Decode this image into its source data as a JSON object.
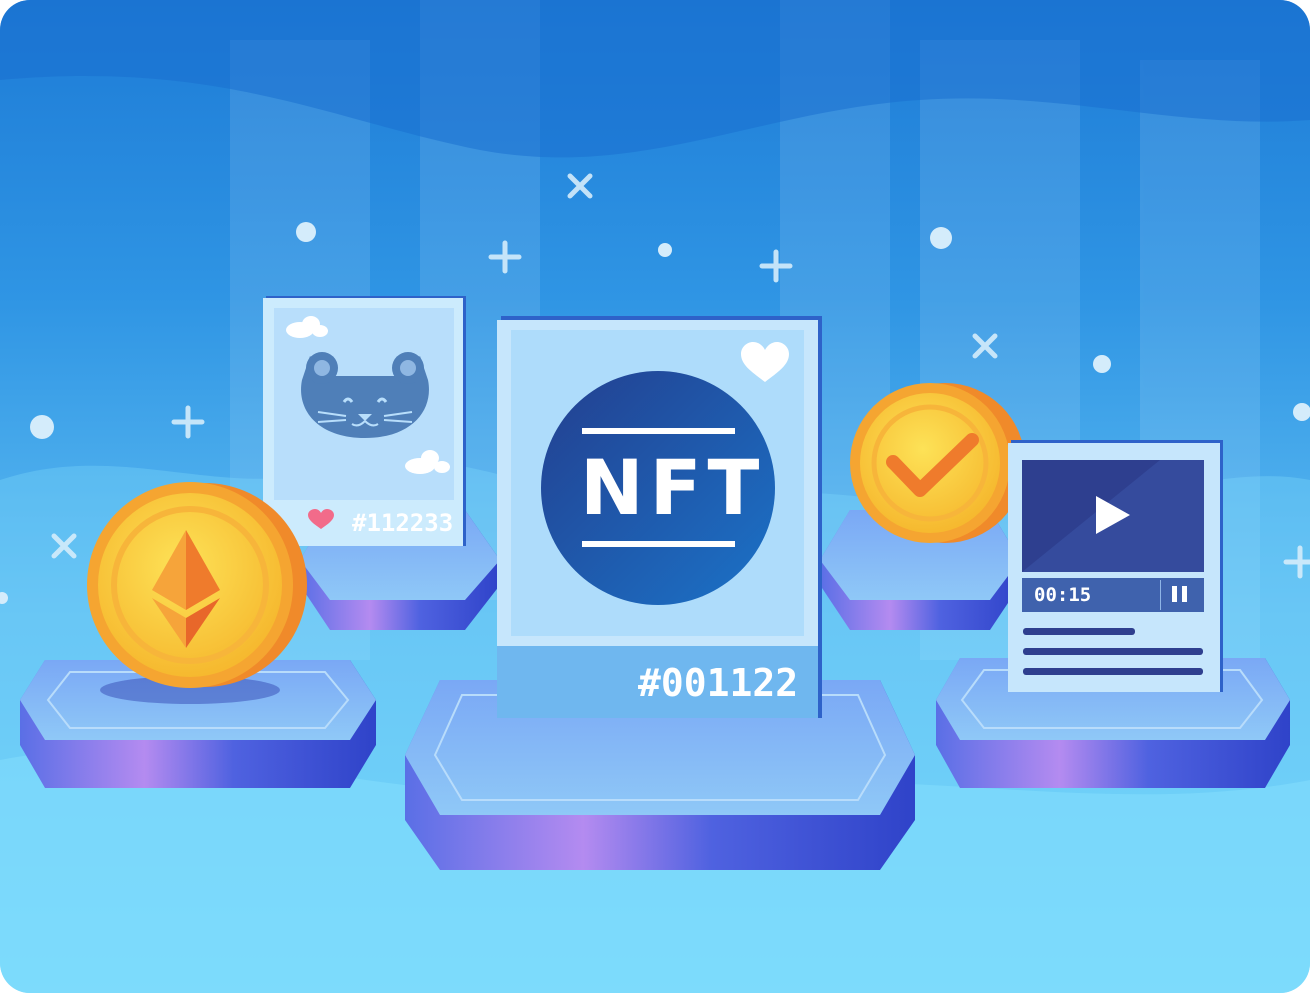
{
  "main_card": {
    "badge_text": "NFT",
    "token_id": "#001122"
  },
  "cat_card": {
    "token_id": "#112233"
  },
  "video_card": {
    "time": "00:15"
  },
  "icons": [
    "ethereum-icon",
    "checkmark-icon",
    "play-icon",
    "pause-icon",
    "heart-icon",
    "cat-icon",
    "cloud-icon"
  ],
  "colors": {
    "sky_top": "#1d7bd6",
    "sky_bottom": "#6fd6fb",
    "card_blue": "#aee2fb",
    "nft_circle": "#1e4f9e",
    "coin_gold": "#f8c23a",
    "coin_orange": "#f08a2a",
    "platform": "#3f5bd8"
  }
}
